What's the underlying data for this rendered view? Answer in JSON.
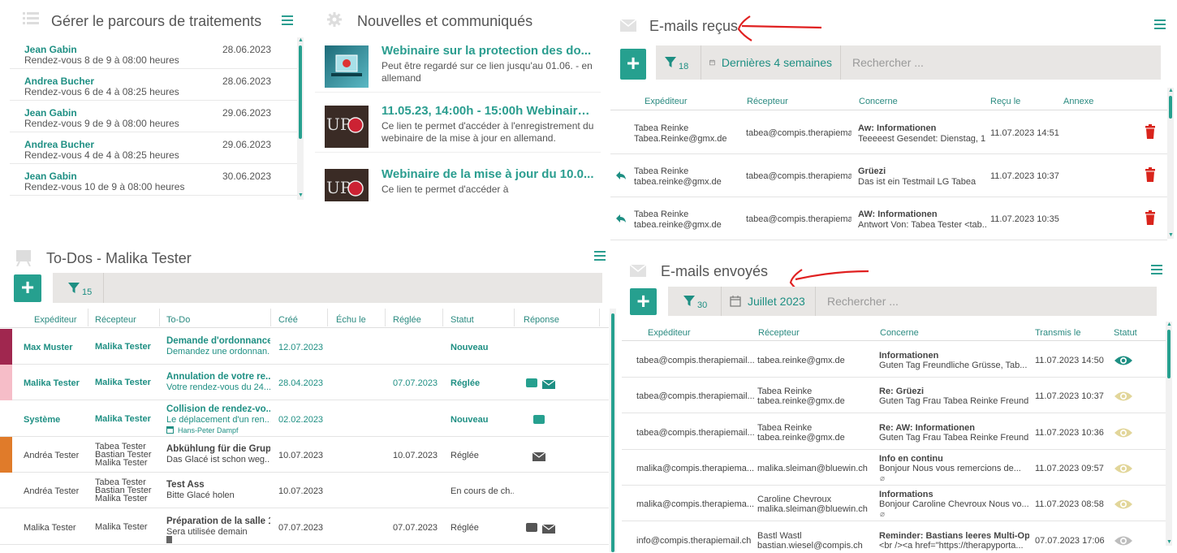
{
  "panel1": {
    "title": "Gérer le parcours de traitements",
    "items": [
      {
        "name": "Jean Gabin",
        "desc": "Rendez-vous 8 de 9 à 08:00 heures",
        "date": "28.06.2023"
      },
      {
        "name": "Andrea Bucher",
        "desc": "Rendez-vous 6 de 4 à 08:25 heures",
        "date": "28.06.2023"
      },
      {
        "name": "Jean Gabin",
        "desc": "Rendez-vous 9 de 9 à 08:00 heures",
        "date": "29.06.2023"
      },
      {
        "name": "Andrea Bucher",
        "desc": "Rendez-vous 4 de 4 à 08:25 heures",
        "date": "29.06.2023"
      },
      {
        "name": "Jean Gabin",
        "desc": "Rendez-vous 10 de 9 à 08:00 heures",
        "date": "30.06.2023"
      }
    ]
  },
  "panel2": {
    "title": "Nouvelles et communiqués",
    "items": [
      {
        "title": "Webinaire sur la protection des do...",
        "text": "Peut être regardé sur ce lien jusqu'au 01.06. - en allemand"
      },
      {
        "title": "11.05.23, 14:00h - 15:00h Webinaire...",
        "text": "Ce lien te permet d'accéder à l'enregistrement du webinaire de la mise à jour en allemand."
      },
      {
        "title": "Webinaire de la mise à jour du 10.0...",
        "text": "Ce lien te permet d'accéder à"
      }
    ]
  },
  "panel3": {
    "title": "E-mails reçus",
    "filter_count": "18",
    "period": "Dernières 4 semaines",
    "search_placeholder": "Rechercher ...",
    "headers": [
      "Expéditeur",
      "Récepteur",
      "Concerne",
      "Reçu le",
      "Annexe"
    ],
    "rows": [
      {
        "sender_name": "Tabea Reinke",
        "sender_email": "Tabea.Reinke@gmx.de",
        "recipient": "tabea@compis.therapiemail...",
        "subject": "Aw: Informationen",
        "preview": "Teeeeest  Gesendet: Dienstag, 1...",
        "date": "11.07.2023 14:51",
        "replied": false
      },
      {
        "sender_name": "Tabea Reinke",
        "sender_email": "tabea.reinke@gmx.de",
        "recipient": "tabea@compis.therapiemail...",
        "subject": "Grüezi",
        "preview": "Das ist ein Testmail   LG  Tabea",
        "date": "11.07.2023 10:37",
        "replied": true
      },
      {
        "sender_name": "Tabea Reinke",
        "sender_email": "tabea.reinke@gmx.de",
        "recipient": "tabea@compis.therapiemail...",
        "subject": "AW: Informationen",
        "preview": "Antwort    Von: Tabea Tester <tab...",
        "date": "11.07.2023 10:35",
        "replied": true
      }
    ]
  },
  "panel4": {
    "title": "To-Dos - Malika Tester",
    "filter_count": "15",
    "headers": [
      "Expéditeur",
      "Récepteur",
      "To-Do",
      "Créé",
      "Échu le",
      "Réglée",
      "Statut",
      "Réponse"
    ],
    "rows": [
      {
        "color": "#a0274f",
        "sender": "Max Muster",
        "recipient": [
          "Malika Tester"
        ],
        "todo_title": "Demande d'ordonnance",
        "todo_text": "Demandez une ordonnan...",
        "todo_extra": "",
        "created": "12.07.2023",
        "due": "",
        "settled": "",
        "status": "Nouveau",
        "teal": true,
        "chat": false,
        "mail": false
      },
      {
        "color": "#f6bdc8",
        "sender": "Malika Tester",
        "recipient": [
          "Malika Tester"
        ],
        "todo_title": "Annulation de votre re...",
        "todo_text": "Votre rendez-vous du 24...",
        "todo_extra": "",
        "created": "28.04.2023",
        "due": "",
        "settled": "07.07.2023",
        "status": "Réglée",
        "teal": true,
        "chat": true,
        "mail": true
      },
      {
        "color": "",
        "sender": "Système",
        "recipient": [
          "Malika Tester"
        ],
        "todo_title": "Collision de rendez-vo...",
        "todo_text": "Le déplacement d'un ren...",
        "todo_extra": "Hans-Peter Dampf",
        "created": "02.02.2023",
        "due": "",
        "settled": "",
        "status": "Nouveau",
        "teal": true,
        "chat": true,
        "mail": false
      },
      {
        "color": "#e07b2a",
        "sender": "Andréa Tester",
        "recipient": [
          "Tabea Tester",
          "Bastian Tester",
          "Malika Tester"
        ],
        "todo_title": "Abkühlung für die Grup...",
        "todo_text": "Das Glacé ist schon weg...",
        "todo_extra": "",
        "created": "10.07.2023",
        "due": "",
        "settled": "10.07.2023",
        "status": "Réglée",
        "teal": false,
        "chat": false,
        "mail": true
      },
      {
        "color": "",
        "sender": "Andréa Tester",
        "recipient": [
          "Tabea Tester",
          "Bastian Tester",
          "Malika Tester"
        ],
        "todo_title": "Test Ass",
        "todo_text": "Bitte Glacé holen",
        "todo_extra": "",
        "created": "10.07.2023",
        "due": "",
        "settled": "",
        "status": "En cours de ch...",
        "teal": false,
        "chat": false,
        "mail": false
      },
      {
        "color": "",
        "sender": "Malika Tester",
        "recipient": [
          "Malika Tester"
        ],
        "todo_title": "Préparation de la salle 1",
        "todo_text": "Sera utilisée demain",
        "todo_extra": "",
        "created": "07.07.2023",
        "due": "",
        "settled": "07.07.2023",
        "status": "Réglée",
        "teal": false,
        "chat": true,
        "mail": true
      }
    ]
  },
  "panel5": {
    "title": "E-mails envoyés",
    "filter_count": "30",
    "period": "Juillet 2023",
    "search_placeholder": "Rechercher ...",
    "headers": [
      "Expéditeur",
      "Récepteur",
      "Concerne",
      "Transmis le",
      "Statut"
    ],
    "rows": [
      {
        "sender": "tabea@compis.therapiemail...",
        "recipient": [
          "tabea.reinke@gmx.de"
        ],
        "subject": "Informationen",
        "preview": "Guten Tag    Freundliche Grüsse, Tab...",
        "date": "11.07.2023 14:50",
        "status_color": "#1e8f83",
        "attach": false
      },
      {
        "sender": "tabea@compis.therapiemail...",
        "recipient": [
          "Tabea Reinke",
          "tabea.reinke@gmx.de"
        ],
        "subject": "Re: Grüezi",
        "preview": "Guten Tag Frau Tabea Reinke  Freund...",
        "date": "11.07.2023 10:37",
        "status_color": "#e2d69a",
        "attach": false
      },
      {
        "sender": "tabea@compis.therapiemail...",
        "recipient": [
          "Tabea Reinke",
          "tabea.reinke@gmx.de"
        ],
        "subject": "Re: AW: Informationen",
        "preview": "Guten Tag Frau Tabea Reinke  Freund...",
        "date": "11.07.2023 10:36",
        "status_color": "#e2d69a",
        "attach": false
      },
      {
        "sender": "malika@compis.therapiema...",
        "recipient": [
          "malika.sleiman@bluewin.ch"
        ],
        "subject": "Info en continu",
        "preview": "Bonjour    Nous vous remercions de...",
        "date": "11.07.2023 09:57",
        "status_color": "#e2d69a",
        "attach": true
      },
      {
        "sender": "malika@compis.therapiema...",
        "recipient": [
          "Caroline Chevroux",
          "malika.sleiman@bluewin.ch"
        ],
        "subject": "Informations",
        "preview": "Bonjour Caroline Chevroux  Nous vo...",
        "date": "11.07.2023 08:58",
        "status_color": "#e2d69a",
        "attach": true
      },
      {
        "sender": "info@compis.therapiemail.ch",
        "recipient": [
          "Bastl Wastl",
          "bastian.wiesel@compis.ch"
        ],
        "subject": "Reminder: Bastians leeres Multi-Op...",
        "preview": "<br /><a href=\"https://therapyporta...",
        "date": "07.07.2023 17:06",
        "status_color": "#bdbdbd",
        "attach": false
      }
    ]
  }
}
